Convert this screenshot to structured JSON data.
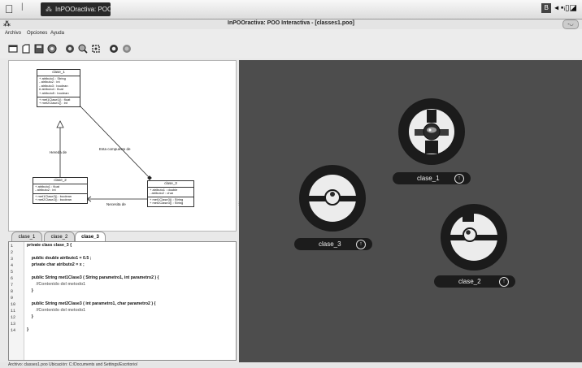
{
  "taskbar": {
    "task_label": "InPOOractiva: POO I...",
    "tray_box": "B"
  },
  "window": {
    "title": "InPOOractiva: POO Interactiva - [classes1.poo]",
    "control_glyph": "-◡"
  },
  "menu": [
    "Archivo",
    "Opciones",
    "Ayuda"
  ],
  "toolbar": {
    "icons": [
      "new-file-icon",
      "open-file-icon",
      "save-icon",
      "navigate-icon",
      "info-icon",
      "zoom-icon",
      "settings-icon",
      "play-icon",
      "stop-icon"
    ]
  },
  "diagram": {
    "classes": [
      {
        "name": "clase_1",
        "attributes": [
          "+ atributo1 : String",
          "- atributo2 : int",
          "- atributo3 : boolean",
          "# atributo4 : float",
          "+ atributo5 : boolean"
        ],
        "methods": [
          "+ met1Clase1() : float",
          "+ met2Clase1() : int"
        ]
      },
      {
        "name": "clase_2",
        "attributes": [
          "+ atributo1 : float",
          "- atributo2 : int"
        ],
        "methods": [
          "+ met1Clase2() : boolean",
          "+ met2Clase2() : boolean"
        ]
      },
      {
        "name": "clase_3",
        "attributes": [
          "+ atributo1 : double",
          "- atributo2 : char"
        ],
        "methods": [
          "+ met1Clase3() : String",
          "+ met2Clase3() : String"
        ]
      }
    ],
    "relations": {
      "inherits": "Hereda de",
      "composed": "Esta compuesto de",
      "needs": "Necesita de"
    }
  },
  "tabs": [
    {
      "label": "clase_1",
      "active": false
    },
    {
      "label": "clase_2",
      "active": false
    },
    {
      "label": "clase_3",
      "active": true
    }
  ],
  "editor": {
    "line_numbers": [
      "1",
      "2",
      "3",
      "4",
      "5",
      "6",
      "7",
      "8",
      "9",
      "10",
      "11",
      "12",
      "13",
      "14"
    ],
    "lines": [
      "private class clase_3 {",
      "",
      "    public double atributo1 = 0.5 ;",
      "    private char atributo2 = x ;",
      "",
      "    public String met1Clase3 ( String parametro1, int parametro2 ) {",
      "        //Contenido del metodo1",
      "    }",
      "",
      "    public String met2Clase3 ( int parametro1, char parametro2 ) {",
      "        //Contenido del metodo1",
      "    }",
      "",
      "}"
    ]
  },
  "canvas": {
    "nodes": [
      {
        "label": "clase_1",
        "button": "↑"
      },
      {
        "label": "clase_3",
        "button": "↑"
      },
      {
        "label": "clase_2",
        "button": "↑"
      }
    ]
  },
  "status": {
    "text": "Archivo: classes1.poo   Ubicación: C:/Documents and Settings/Escritorio/"
  }
}
